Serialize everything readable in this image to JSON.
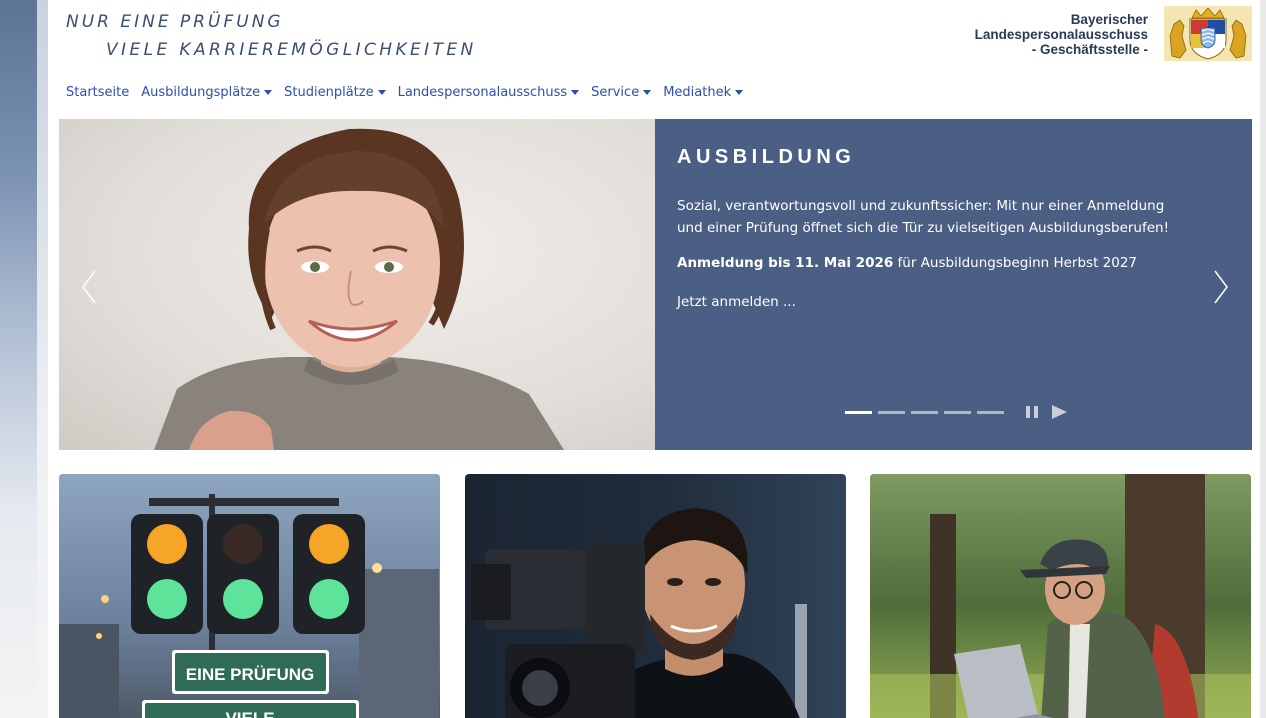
{
  "header": {
    "tagline_line1": "NUR EINE PRÜFUNG",
    "tagline_line2": "VIELE KARRIEREMÖGLICHKEITEN",
    "org_line1": "Bayerischer",
    "org_line2": "Landespersonalausschuss",
    "org_line3": "- Geschäftsstelle -",
    "crest_icon": "bavarian-coat-of-arms-icon"
  },
  "nav": {
    "items": [
      {
        "label": "Startseite",
        "dropdown": false
      },
      {
        "label": "Ausbildungsplätze",
        "dropdown": true
      },
      {
        "label": "Studienplätze",
        "dropdown": true
      },
      {
        "label": "Landespersonalausschuss",
        "dropdown": true
      },
      {
        "label": "Service",
        "dropdown": true
      },
      {
        "label": "Mediathek",
        "dropdown": true
      }
    ]
  },
  "hero": {
    "title": "AUSBILDUNG",
    "text": "Sozial, verantwortungsvoll und zukunftssicher: Mit nur einer Anmeldung und einer Prüfung öffnet sich die Tür zu vielseitigen Ausbildungsberufen!",
    "date_bold": "Anmeldung bis 11. Mai 2026",
    "date_rest": " für Ausbildungsbeginn Herbst 2027",
    "link": "Jetzt anmelden ...",
    "slide_count": 5,
    "active_slide": 1,
    "panel_color": "#4a5f83"
  },
  "cards": [
    {
      "sign1": "EINE PRÜFUNG",
      "sign2": "VIELE"
    },
    {},
    {}
  ],
  "colors": {
    "link": "#2b4fb0",
    "tagline": "#3b4f6e",
    "org": "#2a3a55"
  }
}
